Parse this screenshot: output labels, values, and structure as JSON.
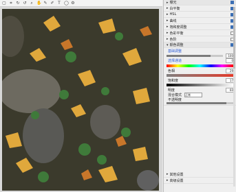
{
  "toolbar": {
    "icons": [
      "select-icon",
      "crop-icon",
      "rotate-icon",
      "undo-icon",
      "zoom-icon",
      "hand-icon",
      "eyedropper-icon",
      "brush-icon",
      "text-icon",
      "shape-icon",
      "settings-icon"
    ]
  },
  "panel": {
    "rows": [
      {
        "label": "曝光",
        "checked": true
      },
      {
        "label": "白平衡",
        "checked": true
      },
      {
        "label": "HSL",
        "checked": true
      },
      {
        "label": "曲线",
        "checked": true
      },
      {
        "label": "饱和度调整",
        "checked": true
      },
      {
        "label": "色彩平衡",
        "checked": false
      },
      {
        "label": "色阶",
        "checked": false
      },
      {
        "label": "锐化",
        "checked": false
      },
      {
        "label": "降噪调整",
        "checked": false
      }
    ],
    "group_title": "颜色调整",
    "sub_title": "基础调整",
    "value_100": "100",
    "value_0": "0",
    "value_29": "29",
    "value_17": "17",
    "value_60": "60",
    "label_channel": "选择通道",
    "label_hue": "色相",
    "label_sat": "饱和度",
    "label_light": "明度",
    "label_blend": "混合模式",
    "label_opacity": "不透明度",
    "blend_value": "正常",
    "footer1": "其他设置",
    "footer2": "高级设置"
  }
}
